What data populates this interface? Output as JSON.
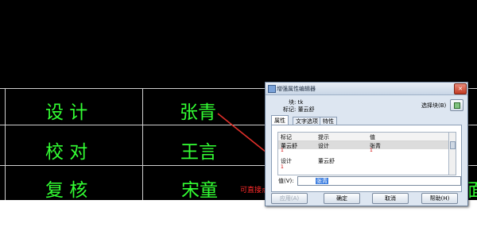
{
  "cad_table": {
    "rows": [
      {
        "label": "设  计",
        "value": "张青"
      },
      {
        "label": "校  对",
        "value": "王言"
      },
      {
        "label": "复  核",
        "value": "宋童"
      }
    ],
    "edge_text": "面"
  },
  "annotation": {
    "text": "可直接点击就可修改内容",
    "color": "#ff2a2a"
  },
  "dialog": {
    "title": "增强属性编辑器",
    "close_label": "✕",
    "block_label": "块: tk",
    "tag_label": "标记: 董云舒",
    "select_block_label": "选择块(B)",
    "tabs": [
      "属性",
      "文字选项",
      "特性"
    ],
    "grid": {
      "headers": [
        "标记",
        "提示",
        "值"
      ],
      "rows": [
        {
          "tag": "董云舒",
          "prompt": "设计",
          "value": "张青",
          "selected": true
        },
        {
          "tag": "1",
          "prompt": "",
          "value": "1"
        },
        {
          "tag": "设计",
          "prompt": "董云舒",
          "value": ""
        },
        {
          "tag": "1",
          "prompt": "",
          "value": ""
        }
      ]
    },
    "value_label": "值(V):",
    "value_text": "张青",
    "buttons": {
      "apply": "应用(A)",
      "ok": "确定",
      "cancel": "取消",
      "help": "帮助(H)"
    }
  },
  "colors": {
    "cad_text": "#33ff33",
    "background": "#000000",
    "dialog_bg": "#dde6f1"
  }
}
